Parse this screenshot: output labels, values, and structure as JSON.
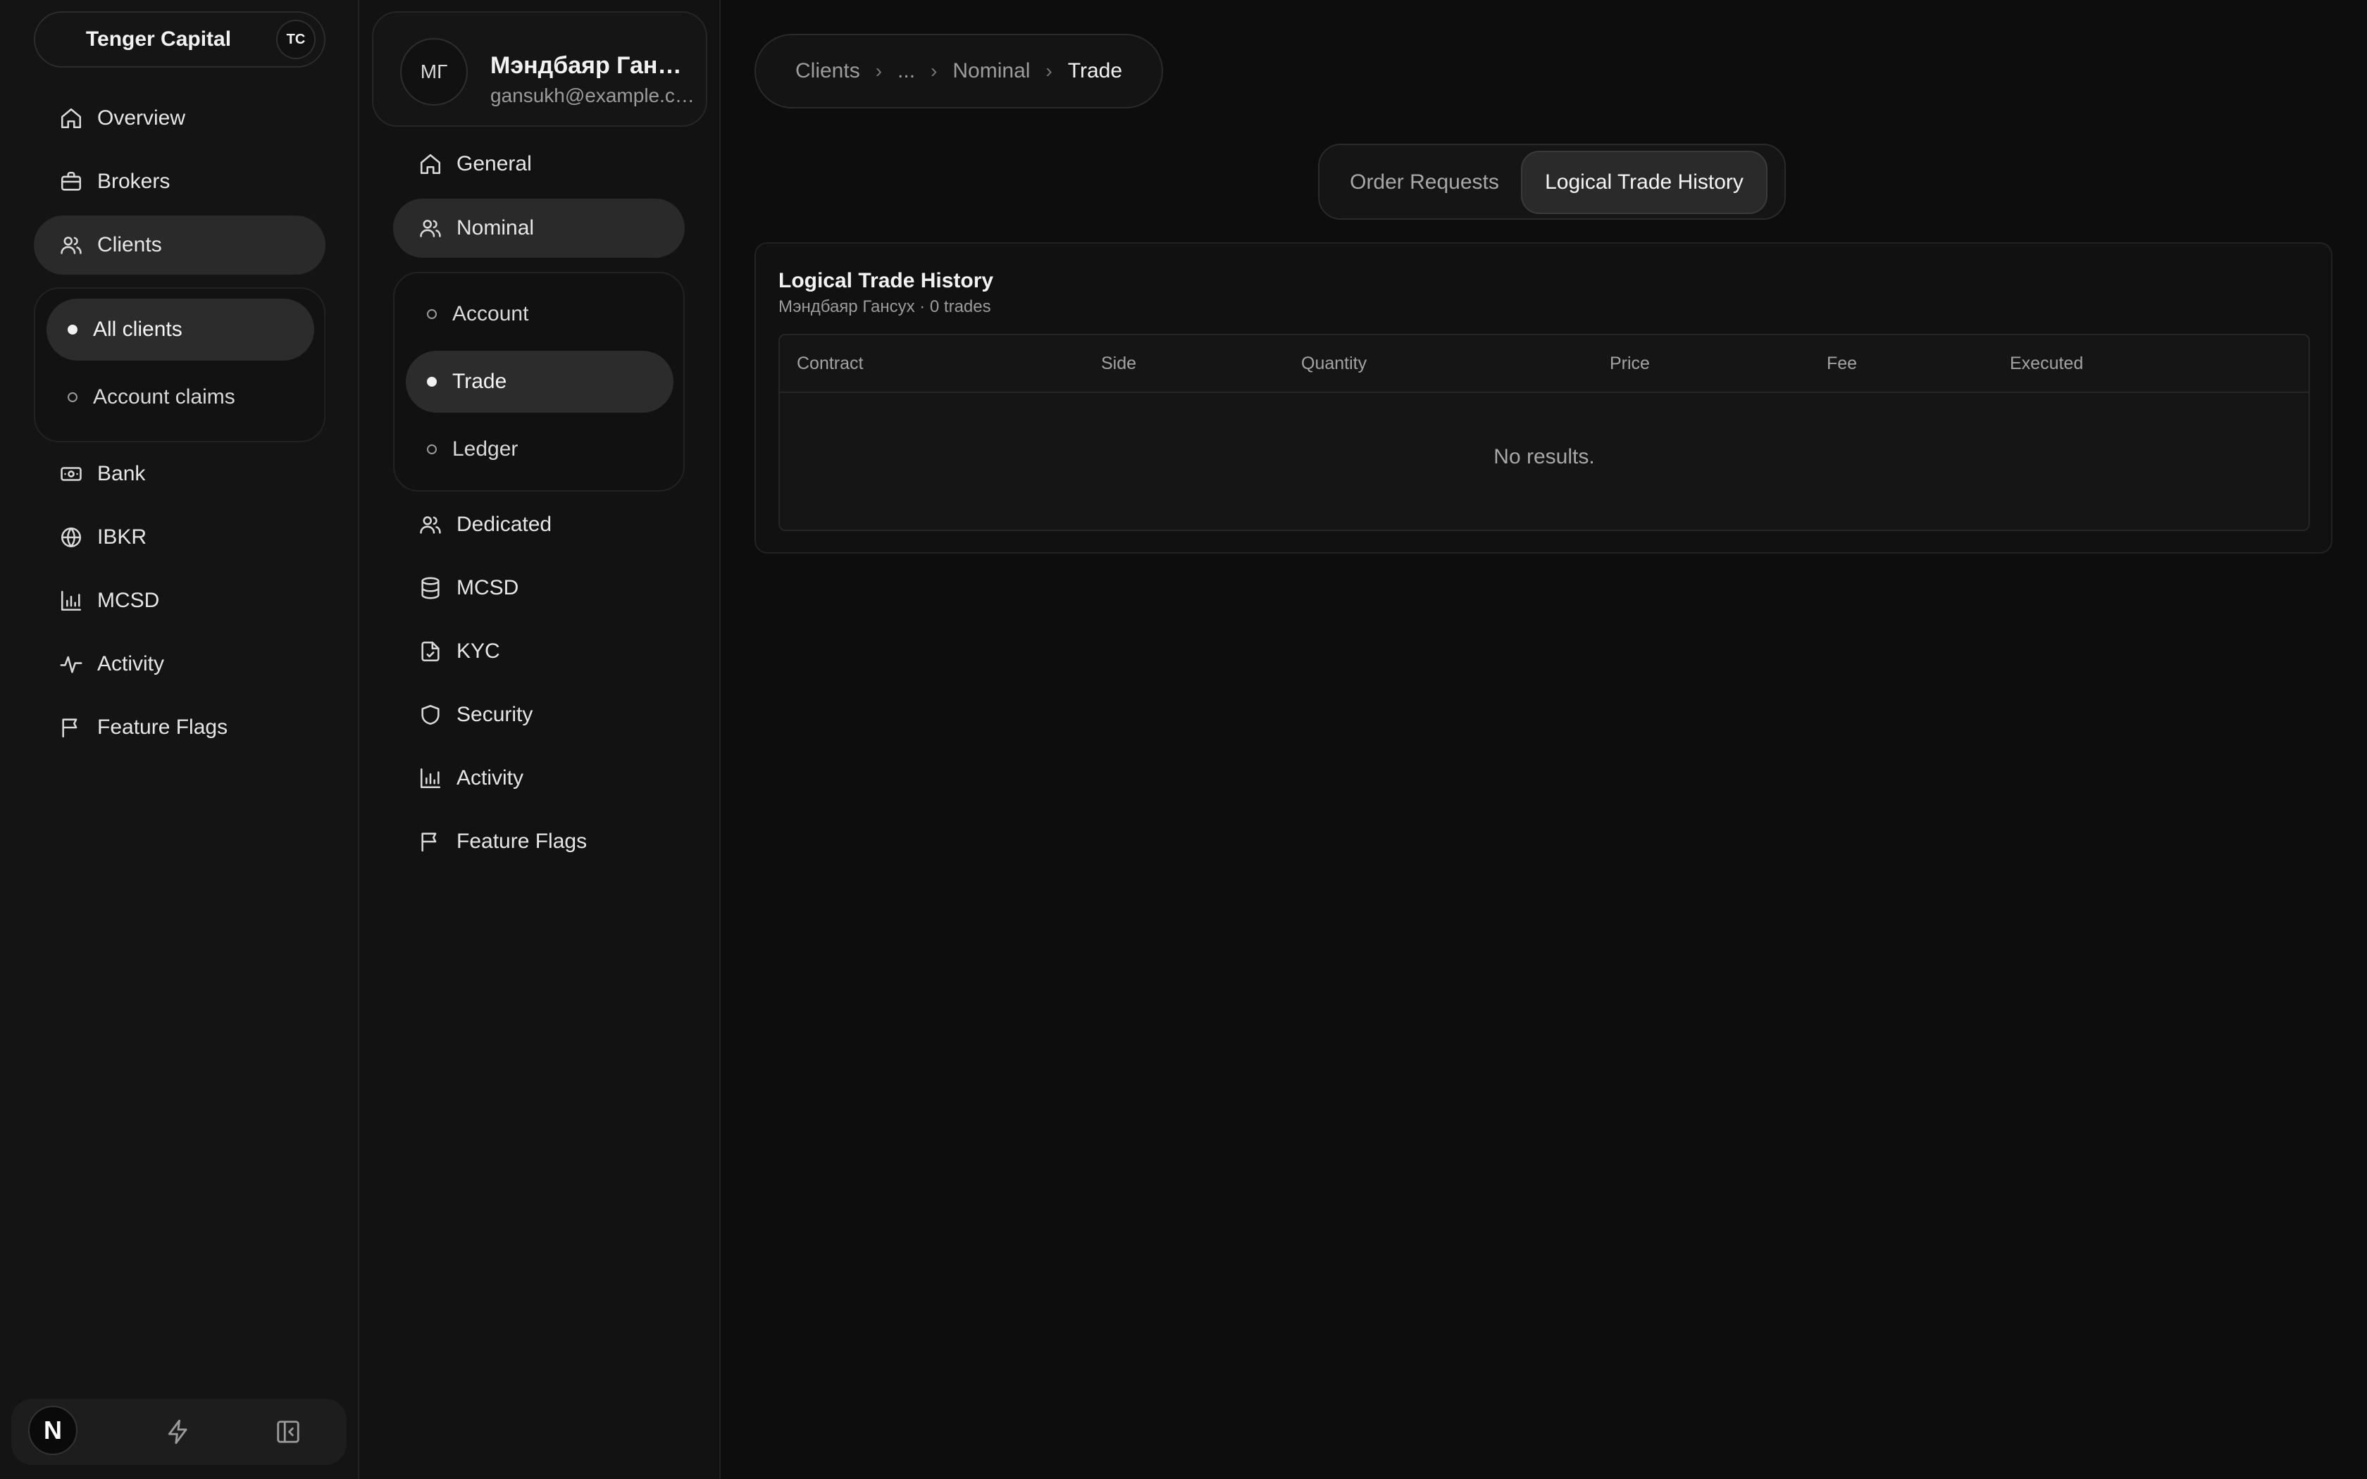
{
  "sidebar": {
    "brand": {
      "name": "Tenger Capital",
      "badge": "TC"
    },
    "items": [
      {
        "label": "Overview",
        "icon": "home-icon"
      },
      {
        "label": "Brokers",
        "icon": "briefcase-icon"
      },
      {
        "label": "Clients",
        "icon": "users-icon",
        "active": true
      },
      {
        "label": "Bank",
        "icon": "banknote-icon"
      },
      {
        "label": "IBKR",
        "icon": "globe-icon"
      },
      {
        "label": "MCSD",
        "icon": "bar-chart-icon"
      },
      {
        "label": "Activity",
        "icon": "activity-icon"
      },
      {
        "label": "Feature Flags",
        "icon": "flag-icon"
      }
    ],
    "clients_sub": [
      {
        "label": "All clients",
        "active": true
      },
      {
        "label": "Account claims"
      }
    ],
    "footer": {
      "logo": "N"
    }
  },
  "client_nav": {
    "user": {
      "initials": "МГ",
      "name": "Мэндбаяр Гансух",
      "email": "gansukh@example.com"
    },
    "items": [
      {
        "label": "General",
        "icon": "home-icon"
      },
      {
        "label": "Nominal",
        "icon": "users-icon",
        "active": true
      },
      {
        "label": "Dedicated",
        "icon": "users-icon"
      },
      {
        "label": "MCSD",
        "icon": "database-icon"
      },
      {
        "label": "KYC",
        "icon": "file-check-icon"
      },
      {
        "label": "Security",
        "icon": "shield-icon"
      },
      {
        "label": "Activity",
        "icon": "bar-chart-icon"
      },
      {
        "label": "Feature Flags",
        "icon": "flag-icon"
      }
    ],
    "nominal_sub": [
      {
        "label": "Account"
      },
      {
        "label": "Trade",
        "active": true
      },
      {
        "label": "Ledger"
      }
    ]
  },
  "breadcrumb": {
    "items": [
      "Clients",
      "...",
      "Nominal"
    ],
    "current": "Trade"
  },
  "tabs": [
    {
      "label": "Order Requests"
    },
    {
      "label": "Logical Trade History",
      "active": true
    }
  ],
  "panel": {
    "title": "Logical Trade History",
    "subtitle": "Мэндбаяр Гансух · 0 trades",
    "columns": [
      "Contract",
      "Side",
      "Quantity",
      "Price",
      "Fee",
      "Executed"
    ],
    "empty_text": "No results."
  }
}
